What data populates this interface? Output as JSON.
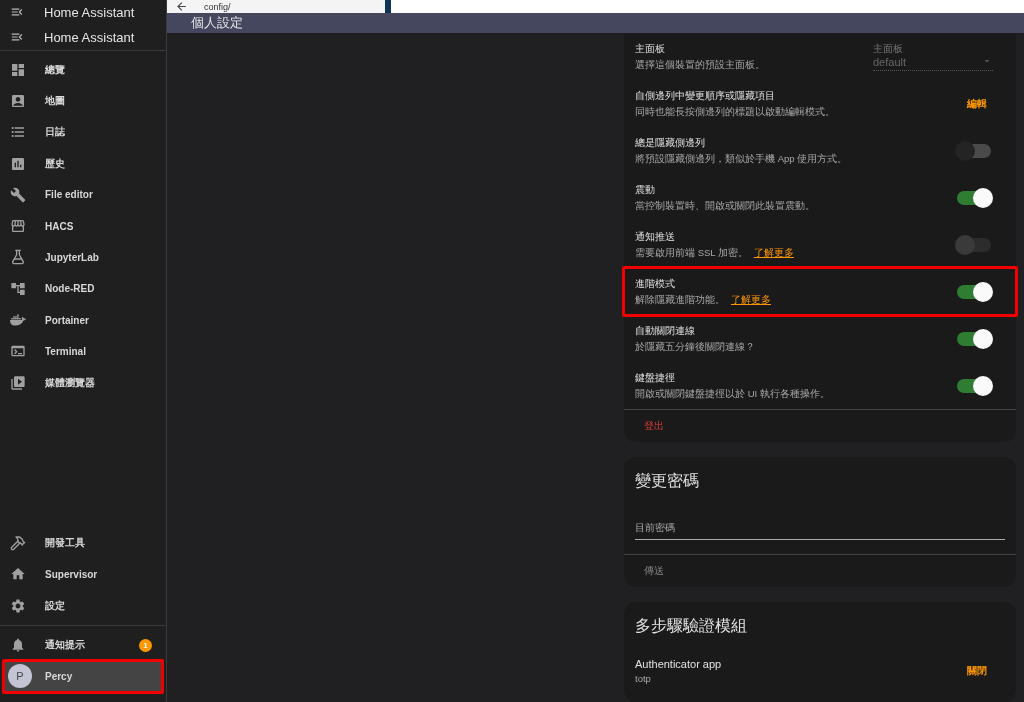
{
  "sidebar": {
    "ghost_title": "Home Assistant",
    "title": "Home Assistant",
    "items": [
      {
        "label": "總覽"
      },
      {
        "label": "地圖"
      },
      {
        "label": "日誌"
      },
      {
        "label": "歷史"
      },
      {
        "label": "File editor"
      },
      {
        "label": "HACS"
      },
      {
        "label": "JupyterLab"
      },
      {
        "label": "Node-RED"
      },
      {
        "label": "Portainer"
      },
      {
        "label": "Terminal"
      },
      {
        "label": "媒體瀏覽器"
      }
    ],
    "bottom_items": [
      {
        "label": "開發工具"
      },
      {
        "label": "Supervisor"
      },
      {
        "label": "設定"
      }
    ],
    "notifications": {
      "label": "通知提示",
      "badge": "1"
    },
    "user": {
      "initial": "P",
      "name": "Percy",
      "highlighted": true
    }
  },
  "browser_bar": {
    "address": "config/"
  },
  "header": {
    "title": "個人設定"
  },
  "settings": [
    {
      "kind": "select",
      "title": "主面板",
      "description": "選擇這個裝置的預設主面板。",
      "field_label": "主面板",
      "value": "default"
    },
    {
      "kind": "action",
      "title": "自側邊列中變更順序或隱藏項目",
      "description": "同時也能長按側邊列的標題以啟動編輯模式。",
      "action": "編輯"
    },
    {
      "kind": "toggle",
      "title": "總是隱藏側邊列",
      "description": "將預設隱藏側邊列，類似於手機 App 使用方式。",
      "on": false,
      "disabled": false
    },
    {
      "kind": "toggle",
      "title": "震動",
      "description": "當控制裝置時、開啟或關閉此裝置震動。",
      "on": true,
      "disabled": false
    },
    {
      "kind": "toggle",
      "title": "通知推送",
      "description": "需要啟用前端 SSL 加密。",
      "link": "了解更多",
      "on": false,
      "disabled": true
    },
    {
      "kind": "toggle",
      "title": "進階模式",
      "description": "解除隱藏進階功能。",
      "link": "了解更多",
      "on": true,
      "disabled": false,
      "highlighted": true
    },
    {
      "kind": "toggle",
      "title": "自動關閉連線",
      "description": "於隱藏五分鐘後關閉連線？",
      "on": true,
      "disabled": false
    },
    {
      "kind": "toggle",
      "title": "鍵盤捷徑",
      "description": "開啟或關閉鍵盤捷徑以於 UI 執行各種操作。",
      "on": true,
      "disabled": false
    }
  ],
  "logout": "登出",
  "password_card": {
    "title": "變更密碼",
    "placeholder": "目前密碼",
    "submit": "傳送",
    "submit_disabled": true
  },
  "mfa_card": {
    "title": "多步驟驗證模組",
    "modules": [
      {
        "name": "Authenticator app",
        "id": "totp",
        "action": "關閉"
      }
    ]
  }
}
